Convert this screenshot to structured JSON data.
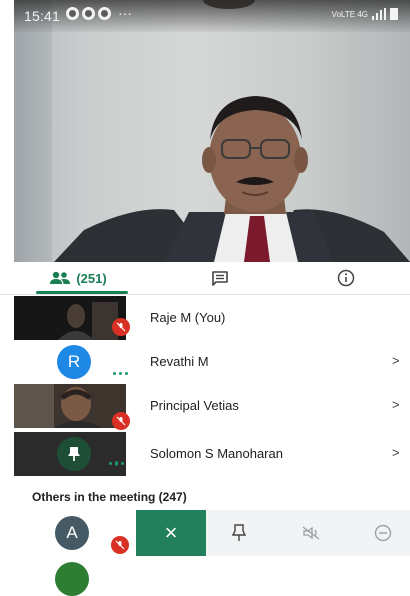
{
  "status_bar": {
    "time": "15:41",
    "more": "···",
    "network": "VoLTE 4G"
  },
  "tabs": {
    "people_count": "(251)",
    "active": "people"
  },
  "participants": [
    {
      "name": "Raje M (You)",
      "has_chevron": false,
      "muted": true
    },
    {
      "name": "Revathi M",
      "avatar_letter": "R",
      "avatar_color": "#1e88e5",
      "has_chevron": true,
      "speaking": true
    },
    {
      "name": "Principal Vetias",
      "has_chevron": true,
      "muted": true
    },
    {
      "name": "Solomon S Manoharan",
      "pinned_icon": "pin-icon",
      "has_chevron": true,
      "speaking": true
    }
  ],
  "chevron": ">",
  "others": {
    "title": "Others in the meeting (247)",
    "first_avatar_letter": "A",
    "first_avatar_color": "#455a64",
    "second_avatar_color": "#2e7d32"
  },
  "action_bar": {
    "close_label": "×",
    "buttons": [
      "pin-icon",
      "mute-remote-icon",
      "remove-icon"
    ]
  },
  "colors": {
    "accent_green": "#1a7f55",
    "mute_red": "#d93025",
    "action_green": "#23805d"
  }
}
